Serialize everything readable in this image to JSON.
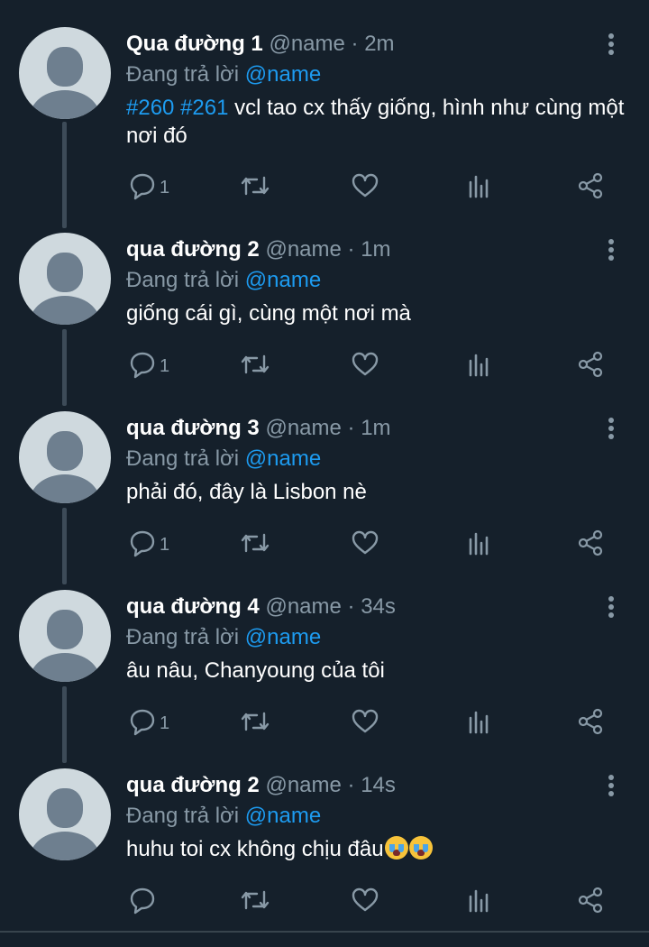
{
  "replying_to_label": "Đang trả lời",
  "tweets": [
    {
      "name": "Qua đường 1",
      "handle": "@name",
      "dot": "·",
      "time": "2m",
      "reply_to": "@name",
      "hashtags": [
        "#260",
        "#261"
      ],
      "text": "vcl tao cx thấy giống, hình như cùng một nơi đó",
      "reply_count": "1"
    },
    {
      "name": "qua đường 2",
      "handle": "@name",
      "dot": "·",
      "time": "1m",
      "reply_to": "@name",
      "text": "giống cái gì, cùng một nơi mà",
      "reply_count": "1"
    },
    {
      "name": "qua đường 3",
      "handle": "@name",
      "dot": "·",
      "time": "1m",
      "reply_to": "@name",
      "text": "phải đó, đây là Lisbon nè",
      "reply_count": "1"
    },
    {
      "name": "qua đường 4",
      "handle": "@name",
      "dot": "·",
      "time": "34s",
      "reply_to": "@name",
      "text": "âu nâu, Chanyoung của tôi",
      "reply_count": "1"
    },
    {
      "name": "qua đường 2",
      "handle": "@name",
      "dot": "·",
      "time": "14s",
      "reply_to": "@name",
      "text": "huhu toi cx không chịu đâu",
      "emoji": [
        "loudly-crying-face",
        "loudly-crying-face"
      ],
      "reply_count": ""
    }
  ],
  "colors": {
    "background": "#15202b",
    "accent": "#1d9bf0",
    "muted": "#8899a6"
  },
  "icons": [
    "reply-icon",
    "retweet-icon",
    "like-icon",
    "analytics-icon",
    "share-icon",
    "more-options-icon"
  ]
}
